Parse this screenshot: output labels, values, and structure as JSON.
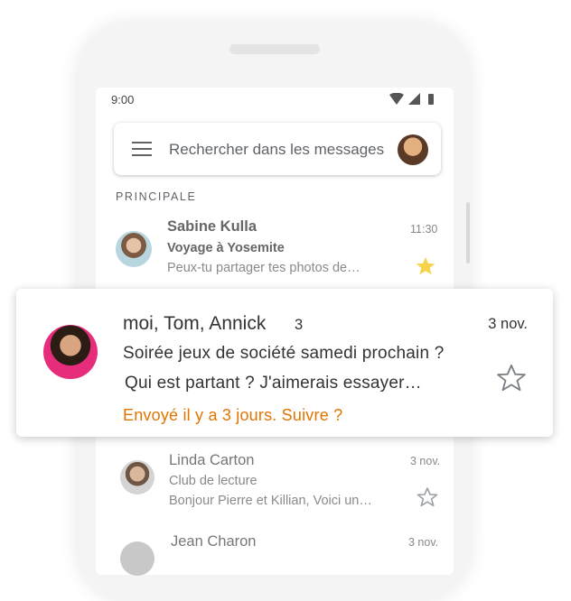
{
  "status_bar": {
    "time": "9:00"
  },
  "search": {
    "placeholder": "Rechercher dans les messages"
  },
  "section_label": "PRINCIPALE",
  "emails": [
    {
      "sender": "Sabine Kulla",
      "subject": "Voyage à Yosemite",
      "snippet": "Peux-tu partager tes photos de…",
      "time": "11:30",
      "starred": true
    },
    {
      "sender": "Linda Carton",
      "subject": "Club de lecture",
      "snippet": "Bonjour Pierre et Killian, Voici un…",
      "time": "3 nov.",
      "starred": false
    },
    {
      "sender": "Jean Charon",
      "time": "3 nov."
    }
  ],
  "highlighted": {
    "senders": "moi, Tom, Annick",
    "count": "3",
    "date": "3 nov.",
    "subject": "Soirée jeux de société samedi prochain ?",
    "snippet": "Qui est partant ? J'aimerais essayer…",
    "followup": "Envoyé il y a 3 jours. Suivre ?",
    "starred": false
  },
  "colors": {
    "followup": "#e37400",
    "star_filled": "#f6d34b"
  },
  "icons": {
    "menu": "hamburger-menu-icon",
    "wifi": "wifi-icon",
    "signal": "signal-icon",
    "battery": "battery-icon",
    "star": "star-icon"
  }
}
